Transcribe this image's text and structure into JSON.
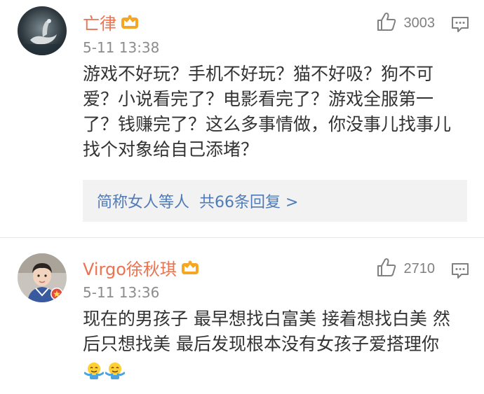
{
  "comments": [
    {
      "username": "亡律",
      "timestamp": "5-11 13:38",
      "likes": "3003",
      "content": "游戏不好玩？手机不好玩？猫不好吸？狗不可爱？小说看完了？电影看完了？游戏全服第一了？钱赚完了？这么多事情做，你没事儿找事儿找个对象给自己添堵？",
      "replies": {
        "author": "简称女人等人",
        "summary": "共66条回复 >"
      }
    },
    {
      "username": "Virgo徐秋琪",
      "timestamp": "5-11 13:36",
      "likes": "2710",
      "content": "现在的男孩子 最早想找白富美 接着想找白美 然后只想找美 最后发现根本没有女孩子爱搭理你"
    }
  ],
  "icons": {
    "like": "thumbs-up-icon",
    "reply": "comment-icon",
    "badge": "crown-badge-icon",
    "emoji": "shrug-emoji-icon"
  },
  "colors": {
    "username": "#eb7350",
    "link": "#4f7bb8",
    "text": "#333333",
    "meta": "#8c8c8c",
    "badge": "#f5a623"
  }
}
